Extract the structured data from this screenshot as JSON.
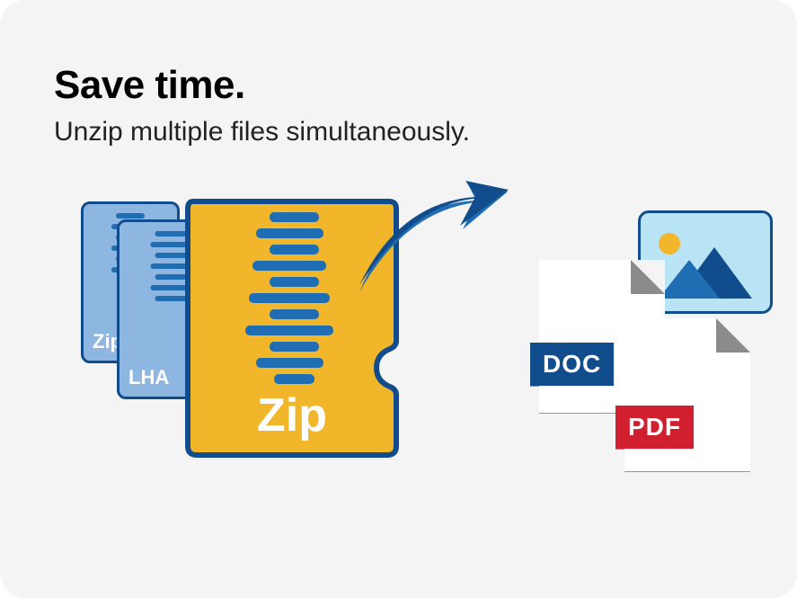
{
  "heading": "Save time.",
  "subheading": "Unzip multiple files simultaneously.",
  "archives": {
    "back1_label": "Zip",
    "back2_label": "LHA",
    "main_label": "Zip"
  },
  "outputs": {
    "doc_label": "DOC",
    "pdf_label": "PDF"
  },
  "colors": {
    "yellow": "#f2b62b",
    "blue_dark": "#114d8c",
    "blue_mid": "#1f6db3",
    "blue_light": "#8db6e0",
    "sky": "#b9e4f5",
    "red": "#d01f2e",
    "sun": "#f2b62b"
  }
}
